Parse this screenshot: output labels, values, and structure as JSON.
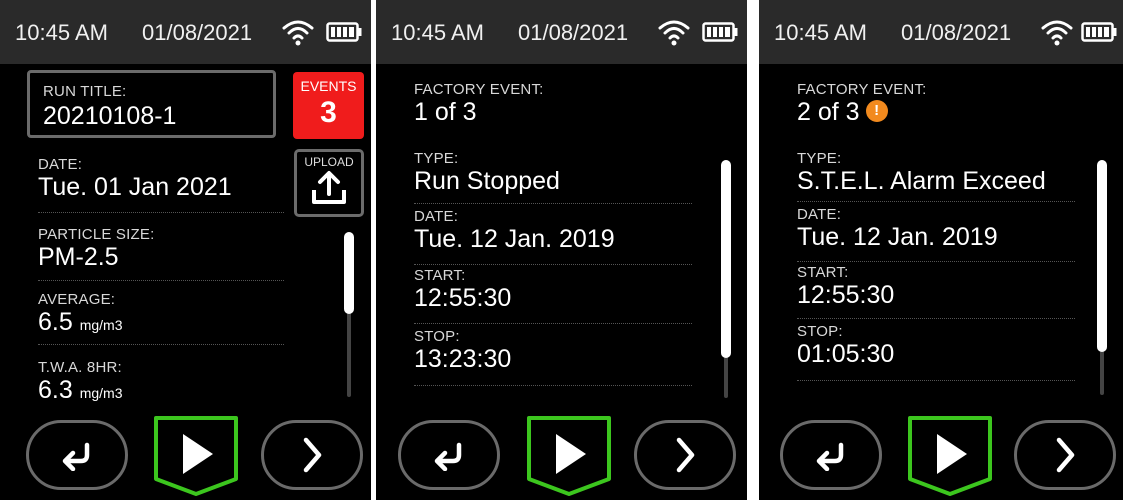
{
  "status": {
    "time": "10:45 AM",
    "date": "01/08/2021"
  },
  "screen1": {
    "run_title_label": "RUN TITLE:",
    "run_title": "20210108-1",
    "events_label": "EVENTS",
    "events_count": "3",
    "upload_label": "UPLOAD",
    "date_label": "DATE:",
    "date": "Tue. 01 Jan 2021",
    "particle_label": "PARTICLE SIZE:",
    "particle": "PM-2.5",
    "average_label": "AVERAGE:",
    "average_value": "6.5",
    "average_unit": "mg/m3",
    "twa_label": "T.W.A. 8HR:",
    "twa_value": "6.3",
    "twa_unit": "mg/m3"
  },
  "screen2": {
    "event_label": "FACTORY EVENT:",
    "event_index": "1 of 3",
    "type_label": "TYPE:",
    "type": "Run Stopped",
    "date_label": "DATE:",
    "date": "Tue. 12 Jan. 2019",
    "start_label": "START:",
    "start": "12:55:30",
    "stop_label": "STOP:",
    "stop": "13:23:30"
  },
  "screen3": {
    "event_label": "FACTORY EVENT:",
    "event_index": "2 of 3",
    "warning_glyph": "!",
    "type_label": "TYPE:",
    "type": "S.T.E.L. Alarm Exceed",
    "date_label": "DATE:",
    "date": "Tue. 12 Jan. 2019",
    "start_label": "START:",
    "start": "12:55:30",
    "stop_label": "STOP:",
    "stop": "01:05:30"
  },
  "colors": {
    "events_red": "#f01c1c",
    "play_green": "#3cc61e",
    "warning_orange": "#f28a1e"
  },
  "icons": [
    "wifi-icon",
    "battery-icon",
    "upload-icon",
    "back-icon",
    "play-icon",
    "next-icon",
    "warning-icon"
  ]
}
